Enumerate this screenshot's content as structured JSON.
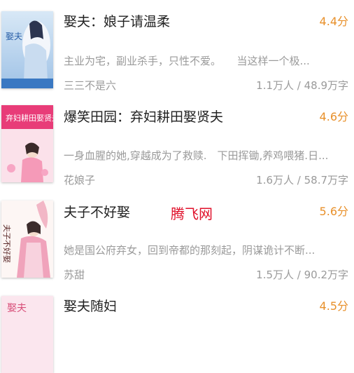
{
  "books": [
    {
      "title": "娶夫：娘子请温柔",
      "score": "4.4分",
      "desc": "主业为宅，副业杀手，只性不爱。　　当这样一个极...",
      "author": "三三不是六",
      "stats": "1.1万人 / 48.9万字",
      "cover_icon": "book-cover-blue",
      "cover_text": "娶夫"
    },
    {
      "title": "爆笑田园：弃妇耕田娶贤夫",
      "score": "4.6分",
      "desc": "一身血腥的她,穿越成为了救赎.　下田挥锄,养鸡喂猪.日...",
      "author": "花娘子",
      "stats": "1.6万人 / 58.7万字",
      "cover_icon": "book-cover-pink",
      "cover_text": "弃妇耕田娶贤夫"
    },
    {
      "title": "夫子不好娶",
      "score": "5.6分",
      "desc": "她是国公府弃女，回到帝都的那刻起，阴谋诡计不断...",
      "author": "苏甜",
      "stats": "1.5万人 / 90.2万字",
      "cover_icon": "book-cover-white",
      "cover_text": "夫子不好娶"
    },
    {
      "title": "娶夫随妇",
      "score": "4.5分",
      "cover_icon": "book-cover-pink-light",
      "cover_text": "娶夫"
    }
  ],
  "watermark": "腾飞网",
  "colors": {
    "score": "#e8902a",
    "title": "#222222",
    "meta": "#9a9a9a",
    "watermark": "#e0102a"
  }
}
